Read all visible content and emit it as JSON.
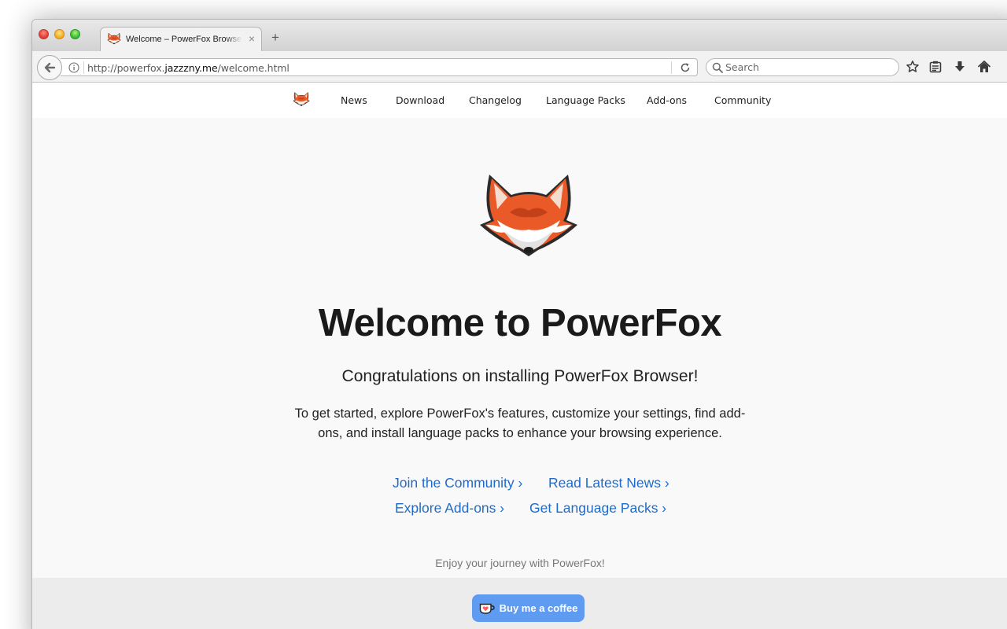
{
  "browser": {
    "tab": {
      "title": "Welcome – PowerFox Browser",
      "close_glyph": "×",
      "favicon": "fox-icon"
    },
    "new_tab_glyph": "+",
    "url": {
      "prefix": "http://powerfox.",
      "domain": "jazzzny.me",
      "path": "/welcome.html"
    },
    "search": {
      "placeholder": "Search"
    },
    "toolbar_icons": [
      "star-icon",
      "reading-list-icon",
      "download-icon",
      "home-icon"
    ]
  },
  "site_nav": {
    "items": [
      {
        "label": "News"
      },
      {
        "label": "Download"
      },
      {
        "label": "Changelog"
      },
      {
        "label": "Language Packs"
      },
      {
        "label": "Add-ons"
      },
      {
        "label": "Community"
      }
    ]
  },
  "hero": {
    "title": "Welcome to PowerFox",
    "subtitle": "Congratulations on installing PowerFox Browser!",
    "description": "To get started, explore PowerFox's features, customize your settings, find add-ons, and install language packs to enhance your browsing experience."
  },
  "links": [
    {
      "label": "Join the Community ›"
    },
    {
      "label": "Read Latest News ›"
    },
    {
      "label": "Explore Add-ons ›"
    },
    {
      "label": "Get Language Packs ›"
    }
  ],
  "footer": {
    "note": "Enjoy your journey with PowerFox!",
    "coffee_label": "Buy me a coffee"
  },
  "colors": {
    "link": "#1f6cc8",
    "coffee_button": "#5f9bf0",
    "fox_orange": "#ea5a28"
  }
}
